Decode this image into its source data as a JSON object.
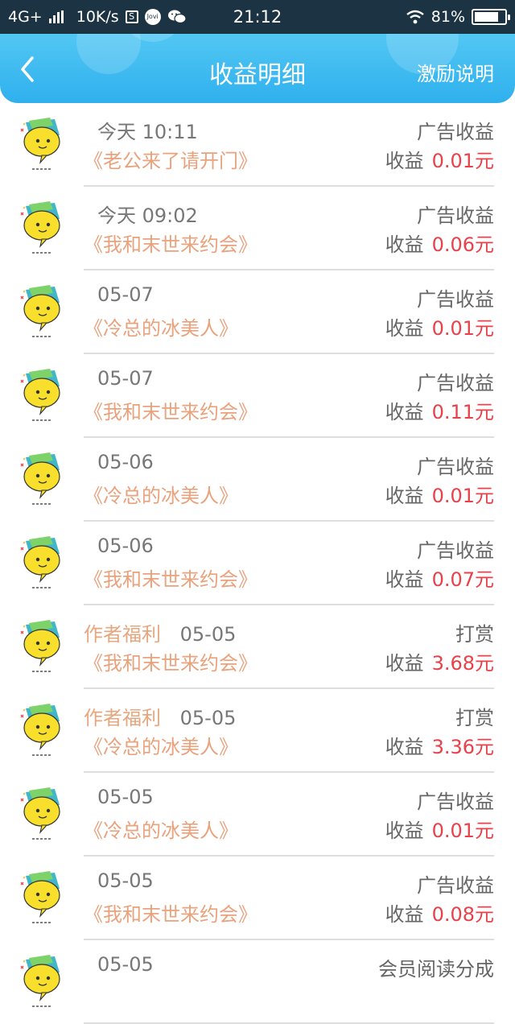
{
  "status": {
    "network": "4G+",
    "speed": "10K/s",
    "jovi": "Jovi",
    "time": "21:12",
    "battery": "81%",
    "battery_level": 0.81
  },
  "header": {
    "title": "收益明细",
    "right_link": "激励说明"
  },
  "colors": {
    "header_top": "#52c7f3",
    "header_bottom": "#2fb0ee",
    "book_title": "#e9a27c",
    "amount_value": "#e8414a"
  },
  "records": [
    {
      "tag": "",
      "datetime": "今天 10:11",
      "book": "《老公来了请开门》",
      "type": "广告收益",
      "amount_label": "收益",
      "amount": "0.01元"
    },
    {
      "tag": "",
      "datetime": "今天 09:02",
      "book": "《我和末世来约会》",
      "type": "广告收益",
      "amount_label": "收益",
      "amount": "0.06元"
    },
    {
      "tag": "",
      "datetime": "05-07",
      "book": "《冷总的冰美人》",
      "type": "广告收益",
      "amount_label": "收益",
      "amount": "0.01元"
    },
    {
      "tag": "",
      "datetime": "05-07",
      "book": "《我和末世来约会》",
      "type": "广告收益",
      "amount_label": "收益",
      "amount": "0.11元"
    },
    {
      "tag": "",
      "datetime": "05-06",
      "book": "《冷总的冰美人》",
      "type": "广告收益",
      "amount_label": "收益",
      "amount": "0.01元"
    },
    {
      "tag": "",
      "datetime": "05-06",
      "book": "《我和末世来约会》",
      "type": "广告收益",
      "amount_label": "收益",
      "amount": "0.07元"
    },
    {
      "tag": "作者福利",
      "datetime": "05-05",
      "book": "《我和末世来约会》",
      "type": "打赏",
      "amount_label": "收益",
      "amount": "3.68元"
    },
    {
      "tag": "作者福利",
      "datetime": "05-05",
      "book": "《冷总的冰美人》",
      "type": "打赏",
      "amount_label": "收益",
      "amount": "3.36元"
    },
    {
      "tag": "",
      "datetime": "05-05",
      "book": "《冷总的冰美人》",
      "type": "广告收益",
      "amount_label": "收益",
      "amount": "0.01元"
    },
    {
      "tag": "",
      "datetime": "05-05",
      "book": "《我和末世来约会》",
      "type": "广告收益",
      "amount_label": "收益",
      "amount": "0.08元"
    },
    {
      "tag": "",
      "datetime": "05-05",
      "book": "",
      "type": "会员阅读分成",
      "amount_label": "",
      "amount": ""
    }
  ]
}
